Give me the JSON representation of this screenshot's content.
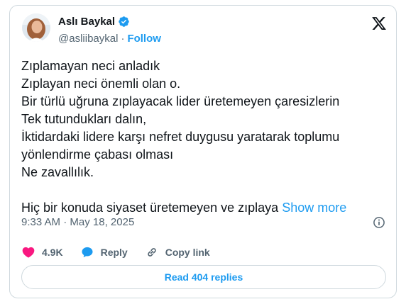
{
  "author": {
    "name": "Aslı Baykal",
    "handle": "@asliibaykal",
    "separator": "·",
    "follow_label": "Follow"
  },
  "tweet": {
    "lines": [
      "Zıplamayan neci anladık",
      "Zıplayan neci önemli olan o.",
      "Bir türlü uğruna zıplayacak lider üretemeyen çaresizlerin",
      "Tek tutundukları dalın,",
      "İktidardaki lidere karşı nefret duygusu yaratarak toplumu",
      "yönlendirme çabası olması",
      "Ne zavallılık."
    ],
    "last_line": "Hiç bir konuda siyaset üretemeyen ve zıplaya",
    "show_more": "Show more"
  },
  "meta": {
    "time": "9:33 AM",
    "separator": "·",
    "date": "May 18, 2025"
  },
  "actions": {
    "likes": "4.9K",
    "reply_label": "Reply",
    "copy_link_label": "Copy link"
  },
  "read_replies_label": "Read 404 replies",
  "colors": {
    "accent": "#1d9bf0",
    "like": "#f91880",
    "text": "#0f1419",
    "secondary": "#536471",
    "border": "#cfd9de"
  },
  "icons": [
    "verified-badge-icon",
    "x-logo-icon",
    "info-icon",
    "heart-icon",
    "reply-bubble-icon",
    "link-icon"
  ]
}
